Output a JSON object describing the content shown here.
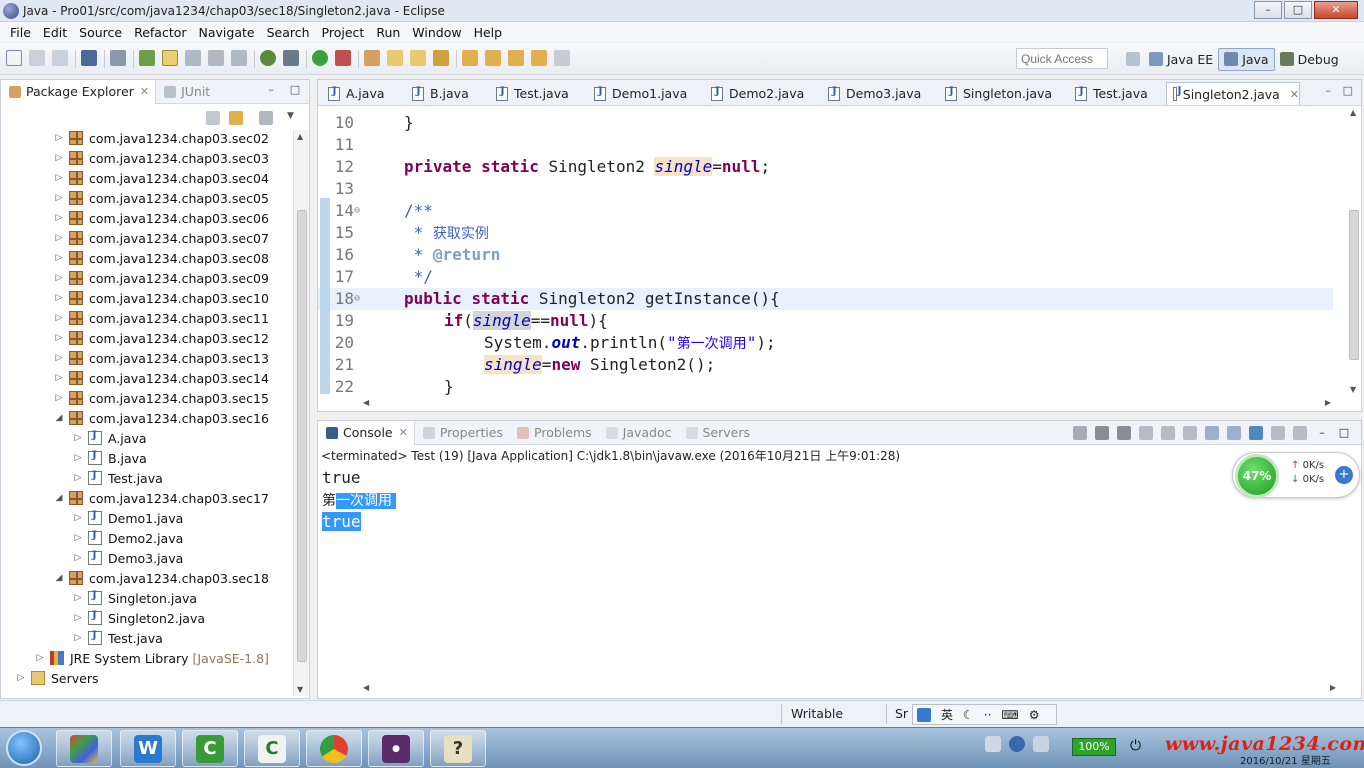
{
  "window": {
    "title": "Java - Pro01/src/com/java1234/chap03/sec18/Singleton2.java - Eclipse",
    "controls": [
      "minimize",
      "maximize",
      "close"
    ]
  },
  "menu": [
    "File",
    "Edit",
    "Source",
    "Refactor",
    "Navigate",
    "Search",
    "Project",
    "Run",
    "Window",
    "Help"
  ],
  "toolbar": {
    "quick_access_placeholder": "Quick Access",
    "perspectives": [
      {
        "label": "Java EE",
        "active": false
      },
      {
        "label": "Java",
        "active": true
      },
      {
        "label": "Debug",
        "active": false
      }
    ]
  },
  "package_explorer": {
    "tabs": [
      {
        "label": "Package Explorer",
        "active": true
      },
      {
        "label": "JUnit",
        "active": false
      }
    ],
    "tree": [
      {
        "label": "com.java1234.chap03.sec02",
        "type": "package",
        "expanded": false,
        "depth": 0
      },
      {
        "label": "com.java1234.chap03.sec03",
        "type": "package",
        "expanded": false,
        "depth": 0
      },
      {
        "label": "com.java1234.chap03.sec04",
        "type": "package",
        "expanded": false,
        "depth": 0
      },
      {
        "label": "com.java1234.chap03.sec05",
        "type": "package",
        "expanded": false,
        "depth": 0
      },
      {
        "label": "com.java1234.chap03.sec06",
        "type": "package",
        "expanded": false,
        "depth": 0
      },
      {
        "label": "com.java1234.chap03.sec07",
        "type": "package",
        "expanded": false,
        "depth": 0
      },
      {
        "label": "com.java1234.chap03.sec08",
        "type": "package",
        "expanded": false,
        "depth": 0
      },
      {
        "label": "com.java1234.chap03.sec09",
        "type": "package",
        "expanded": false,
        "depth": 0
      },
      {
        "label": "com.java1234.chap03.sec10",
        "type": "package",
        "expanded": false,
        "depth": 0
      },
      {
        "label": "com.java1234.chap03.sec11",
        "type": "package",
        "expanded": false,
        "depth": 0
      },
      {
        "label": "com.java1234.chap03.sec12",
        "type": "package",
        "expanded": false,
        "depth": 0
      },
      {
        "label": "com.java1234.chap03.sec13",
        "type": "package",
        "expanded": false,
        "depth": 0
      },
      {
        "label": "com.java1234.chap03.sec14",
        "type": "package",
        "expanded": false,
        "depth": 0
      },
      {
        "label": "com.java1234.chap03.sec15",
        "type": "package",
        "expanded": false,
        "depth": 0
      },
      {
        "label": "com.java1234.chap03.sec16",
        "type": "package",
        "expanded": true,
        "depth": 0
      },
      {
        "label": "A.java",
        "type": "java",
        "expanded": false,
        "depth": 1
      },
      {
        "label": "B.java",
        "type": "java",
        "expanded": false,
        "depth": 1
      },
      {
        "label": "Test.java",
        "type": "java",
        "expanded": false,
        "depth": 1
      },
      {
        "label": "com.java1234.chap03.sec17",
        "type": "package",
        "expanded": true,
        "depth": 0
      },
      {
        "label": "Demo1.java",
        "type": "java",
        "expanded": false,
        "depth": 1
      },
      {
        "label": "Demo2.java",
        "type": "java",
        "expanded": false,
        "depth": 1
      },
      {
        "label": "Demo3.java",
        "type": "java",
        "expanded": false,
        "depth": 1
      },
      {
        "label": "com.java1234.chap03.sec18",
        "type": "package",
        "expanded": true,
        "depth": 0
      },
      {
        "label": "Singleton.java",
        "type": "java",
        "expanded": false,
        "depth": 1
      },
      {
        "label": "Singleton2.java",
        "type": "java",
        "expanded": false,
        "depth": 1
      },
      {
        "label": "Test.java",
        "type": "java",
        "expanded": false,
        "depth": 1
      },
      {
        "label": "JRE System Library",
        "suffix": "[JavaSE-1.8]",
        "type": "library",
        "expanded": false,
        "depth": -1
      },
      {
        "label": "Servers",
        "type": "folder",
        "expanded": false,
        "depth": -2
      }
    ]
  },
  "editor": {
    "tabs": [
      "A.java",
      "B.java",
      "Test.java",
      "Demo1.java",
      "Demo2.java",
      "Demo3.java",
      "Singleton.java",
      "Test.java",
      "Singleton2.java"
    ],
    "active_tab": "Singleton2.java",
    "lines": [
      {
        "n": "10",
        "text": "}"
      },
      {
        "n": "11",
        "text": ""
      },
      {
        "n": "12",
        "parts": [
          "private",
          "static",
          "Singleton2",
          "single",
          "=",
          "null",
          ";"
        ]
      },
      {
        "n": "13",
        "text": ""
      },
      {
        "n": "14",
        "text": "/**"
      },
      {
        "n": "15",
        "prefix": " * ",
        "cjk": "获取实例"
      },
      {
        "n": "16",
        "prefix": " * ",
        "tag": "@return"
      },
      {
        "n": "17",
        "text": " */"
      },
      {
        "n": "18",
        "parts": [
          "public",
          "static",
          "Singleton2 getInstance(){"
        ]
      },
      {
        "n": "19",
        "parts": [
          "if",
          "(",
          "single",
          "==",
          "null",
          "){"
        ]
      },
      {
        "n": "20",
        "parts": [
          "System.",
          "out",
          ".println(\"",
          "第一次调用",
          "\");"
        ]
      },
      {
        "n": "21",
        "parts": [
          "single",
          "=",
          "new",
          " Singleton2();"
        ]
      },
      {
        "n": "22",
        "text": "}"
      }
    ]
  },
  "console": {
    "tabs": [
      {
        "label": "Console",
        "active": true
      },
      {
        "label": "Properties",
        "active": false
      },
      {
        "label": "Problems",
        "active": false
      },
      {
        "label": "Javadoc",
        "active": false
      },
      {
        "label": "Servers",
        "active": false
      }
    ],
    "header": "<terminated> Test (19) [Java Application] C:\\jdk1.8\\bin\\javaw.exe (2016年10月21日 上午9:01:28)",
    "output": [
      "true",
      "第一次调用",
      "true"
    ]
  },
  "net_widget": {
    "percent": "47%",
    "up": "0K/s",
    "down": "0K/s"
  },
  "status": {
    "writable": "Writable",
    "insert": "Sr"
  },
  "ime": {
    "lang": "英"
  },
  "taskbar": {
    "battery": "100%",
    "watermark": "www.java1234.com",
    "clock_date": "2016/10/21 星期五"
  }
}
